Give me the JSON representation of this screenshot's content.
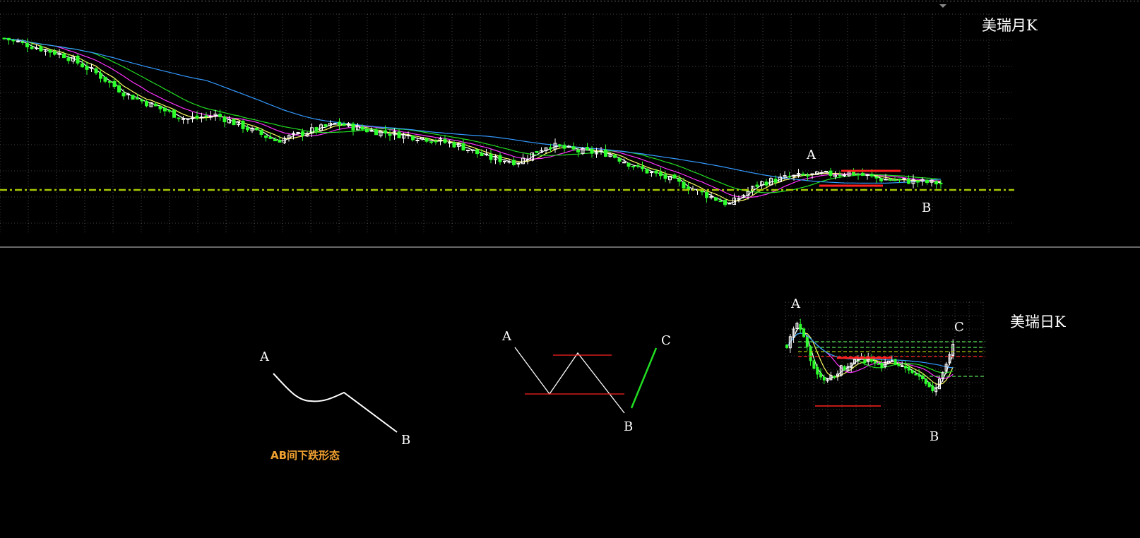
{
  "colors": {
    "background": "#000000",
    "grid": "#5a5a5a",
    "candle_bull": "#2cff2c",
    "candle_bear": "#ffffff",
    "ma5": "#ffffff",
    "ma10": "#ffff66",
    "ma20": "#ff33ff",
    "ma30": "#22dd22",
    "ma60": "#3399ff",
    "support_line": "#a8c800",
    "resistance": "#ff2020",
    "caption": "#f0a030"
  },
  "monthly_chart": {
    "title": "美瑞月K",
    "label_a": "A",
    "label_b": "B"
  },
  "daily_chart": {
    "title": "美瑞日K",
    "label_a": "A",
    "label_b": "B",
    "label_c": "C"
  },
  "diagram1": {
    "label_a": "A",
    "label_b": "B",
    "caption": "AB间下跌形态"
  },
  "diagram2": {
    "label_a": "A",
    "label_b": "B",
    "label_c": "C"
  },
  "chart_data": [
    {
      "type": "candlestick",
      "title": "美瑞月K",
      "ylim": [
        0,
        100
      ],
      "grid": true,
      "note": "relative price trend read from the figure (no axis printed)",
      "ma_lines": [
        "white",
        "yellow",
        "magenta",
        "green",
        "blue"
      ],
      "close_trend": [
        88,
        84,
        80,
        72,
        62,
        56,
        50,
        52,
        46,
        40,
        44,
        48,
        45,
        43,
        41,
        38,
        32,
        30,
        38,
        35,
        34,
        27,
        22,
        16,
        10,
        20,
        23,
        24,
        25,
        22,
        21,
        20
      ],
      "points": {
        "A": 27,
        "B": 20
      }
    },
    {
      "type": "candlestick",
      "title": "美瑞日K",
      "ylim": [
        0,
        100
      ],
      "grid": true,
      "note": "relative price trend read from the figure (no axis printed)",
      "close_trend": [
        70,
        88,
        66,
        40,
        38,
        48,
        52,
        58,
        56,
        52,
        54,
        50,
        48,
        38,
        28,
        42,
        70
      ],
      "points": {
        "A": 88,
        "B": 24,
        "C": 76
      }
    }
  ]
}
